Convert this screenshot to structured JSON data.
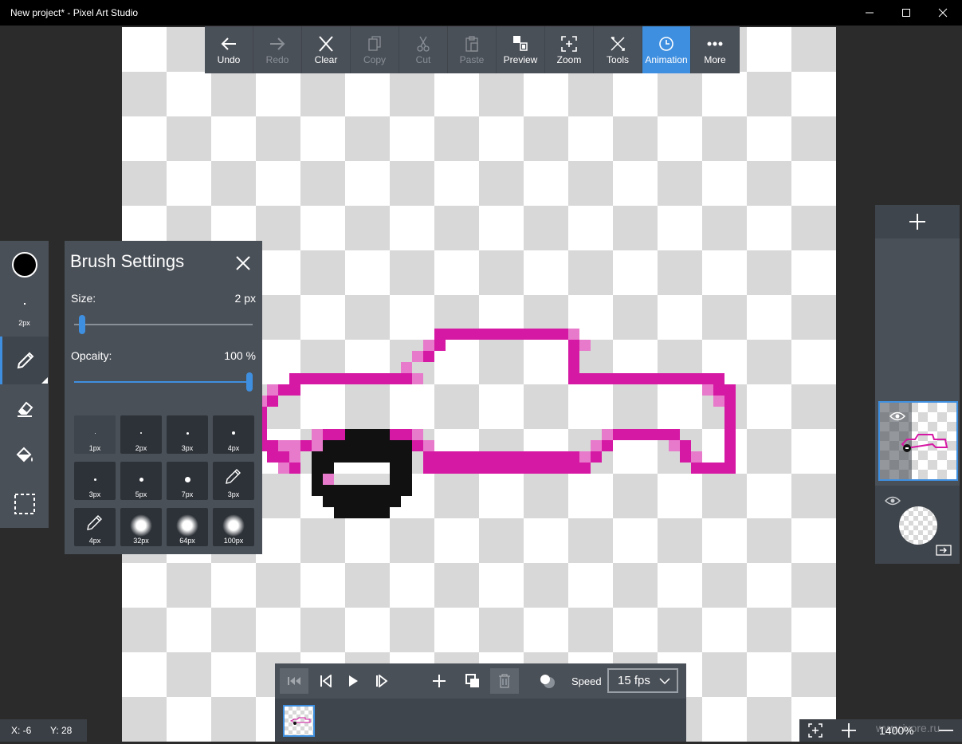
{
  "window": {
    "title": "New project* - Pixel Art Studio"
  },
  "toolbar": {
    "items": [
      {
        "label": "Undo",
        "icon": "arrow-left-icon",
        "enabled": true
      },
      {
        "label": "Redo",
        "icon": "arrow-right-icon",
        "enabled": false
      },
      {
        "label": "Clear",
        "icon": "close-icon",
        "enabled": true
      },
      {
        "label": "Copy",
        "icon": "copy-icon",
        "enabled": false
      },
      {
        "label": "Cut",
        "icon": "scissors-icon",
        "enabled": false
      },
      {
        "label": "Paste",
        "icon": "clipboard-icon",
        "enabled": false
      },
      {
        "label": "Preview",
        "icon": "preview-icon",
        "enabled": true
      },
      {
        "label": "Zoom",
        "icon": "zoom-frame-icon",
        "enabled": true
      },
      {
        "label": "Tools",
        "icon": "tools-icon",
        "enabled": true
      },
      {
        "label": "Animation",
        "icon": "clock-icon",
        "enabled": true,
        "active": true
      },
      {
        "label": "More",
        "icon": "more-dots-icon",
        "enabled": true
      }
    ]
  },
  "left_tools": {
    "color": "#000000",
    "brush_size_label": "2px",
    "selected_tool": "pencil"
  },
  "brush_settings": {
    "title": "Brush Settings",
    "size_label": "Size:",
    "size_value": "2 px",
    "size_fraction": 0.02,
    "opacity_label": "Opcaity:",
    "opacity_value": "100 %",
    "opacity_fraction": 1.0,
    "presets": [
      {
        "label": "1px",
        "kind": "dot",
        "selected": true
      },
      {
        "label": "2px",
        "kind": "dot"
      },
      {
        "label": "3px",
        "kind": "dot"
      },
      {
        "label": "4px",
        "kind": "dot"
      },
      {
        "label": "3px",
        "kind": "dot"
      },
      {
        "label": "5px",
        "kind": "dot"
      },
      {
        "label": "7px",
        "kind": "dot"
      },
      {
        "label": "3px",
        "kind": "pencil"
      },
      {
        "label": "4px",
        "kind": "pencil"
      },
      {
        "label": "32px",
        "kind": "soft"
      },
      {
        "label": "64px",
        "kind": "soft"
      },
      {
        "label": "100px",
        "kind": "soft"
      }
    ]
  },
  "animation": {
    "speed_label": "Speed",
    "speed_value": "15 fps"
  },
  "status": {
    "x": "X: -6",
    "y": "Y: 28"
  },
  "zoom": {
    "value": "1400%",
    "watermark": "www.ixore.ru"
  },
  "colors": {
    "accent": "#3f8fe0",
    "stroke_main": "#d619a4",
    "stroke_light": "#e87acb",
    "wheel": "#111111"
  }
}
